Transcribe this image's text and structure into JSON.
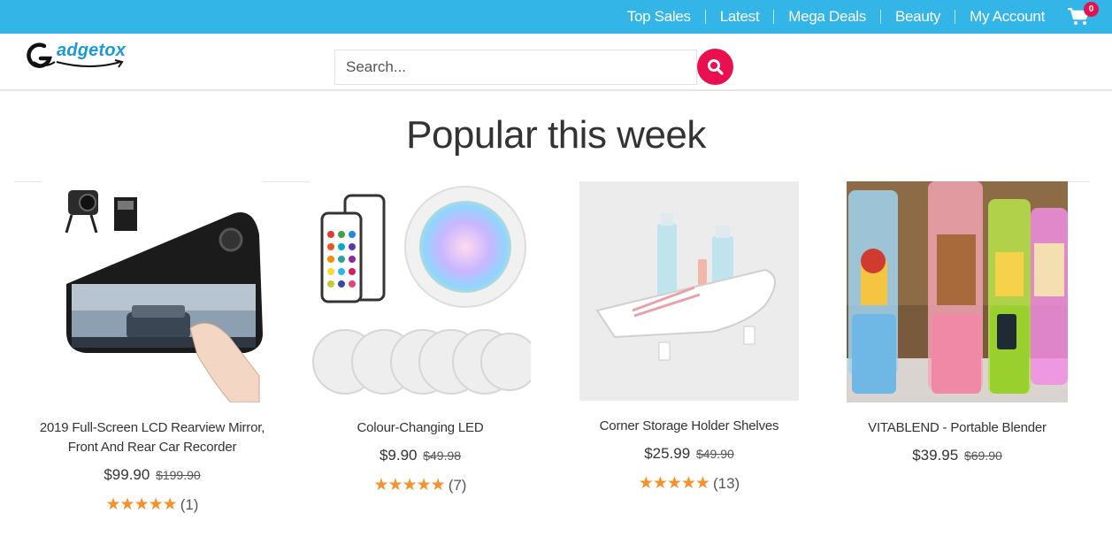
{
  "nav": {
    "items": [
      {
        "label": "Top Sales"
      },
      {
        "label": "Latest"
      },
      {
        "label": "Mega Deals"
      },
      {
        "label": "Beauty"
      },
      {
        "label": "My Account"
      }
    ],
    "cart_count": "0"
  },
  "logo": {
    "text": "adgetox"
  },
  "search": {
    "placeholder": "Search..."
  },
  "section": {
    "title": "Popular this week"
  },
  "products": [
    {
      "title": "2019 Full-Screen LCD Rearview Mirror, Front And Rear Car Recorder",
      "price": "$99.90",
      "old_price": "$199.90",
      "stars": "★★★★★",
      "reviews": "(1)"
    },
    {
      "title": "Colour-Changing LED",
      "price": "$9.90",
      "old_price": "$49.98",
      "stars": "★★★★★",
      "reviews": "(7)"
    },
    {
      "title": "Corner Storage Holder Shelves",
      "price": "$25.99",
      "old_price": "$49.90",
      "stars": "★★★★★",
      "reviews": "(13)"
    },
    {
      "title": "VITABLEND - Portable Blender",
      "price": "$39.95",
      "old_price": "$69.90",
      "stars": "",
      "reviews": ""
    }
  ],
  "colors": {
    "topbar": "#33b5e8",
    "accent": "#ea0f4f",
    "star": "#f5922c"
  }
}
